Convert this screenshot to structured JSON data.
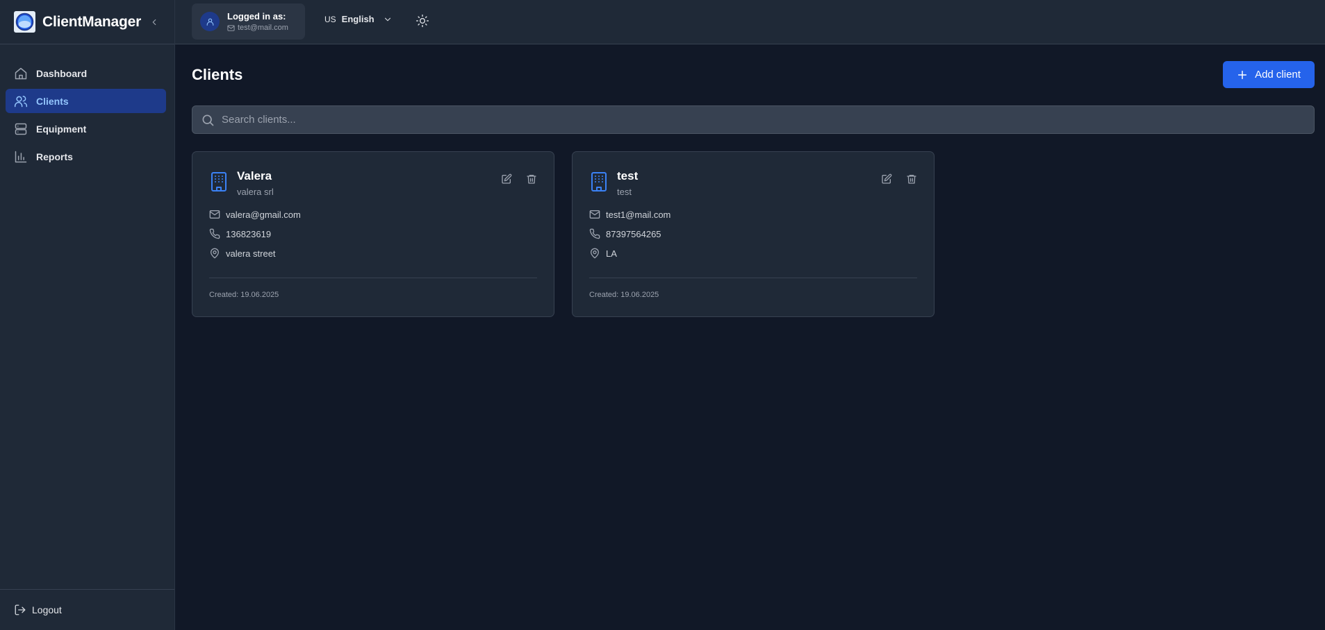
{
  "sidebar": {
    "brand": "ClientManager",
    "items": [
      {
        "label": "Dashboard",
        "icon": "home-icon",
        "active": false
      },
      {
        "label": "Clients",
        "icon": "users-icon",
        "active": true
      },
      {
        "label": "Equipment",
        "icon": "server-icon",
        "active": false
      },
      {
        "label": "Reports",
        "icon": "bar-chart-icon",
        "active": false
      }
    ],
    "logout_label": "Logout"
  },
  "topbar": {
    "user_heading": "Logged in as:",
    "user_email": "test@mail.com",
    "lang_code": "US",
    "lang_name": "English"
  },
  "main": {
    "title": "Clients",
    "add_button_label": "Add client",
    "search_placeholder": "Search clients...",
    "clients": [
      {
        "name": "Valera",
        "company": "valera srl",
        "email": "valera@gmail.com",
        "phone": "136823619",
        "address": "valera street",
        "created": "Created: 19.06.2025"
      },
      {
        "name": "test",
        "company": "test",
        "email": "test1@mail.com",
        "phone": "87397564265",
        "address": "LA",
        "created": "Created: 19.06.2025"
      }
    ]
  },
  "colors": {
    "background": "#111827",
    "panel": "#1f2937",
    "accent": "#2563eb",
    "active_nav_bg": "#1e3a8a",
    "active_nav_text": "#93c5fd"
  }
}
